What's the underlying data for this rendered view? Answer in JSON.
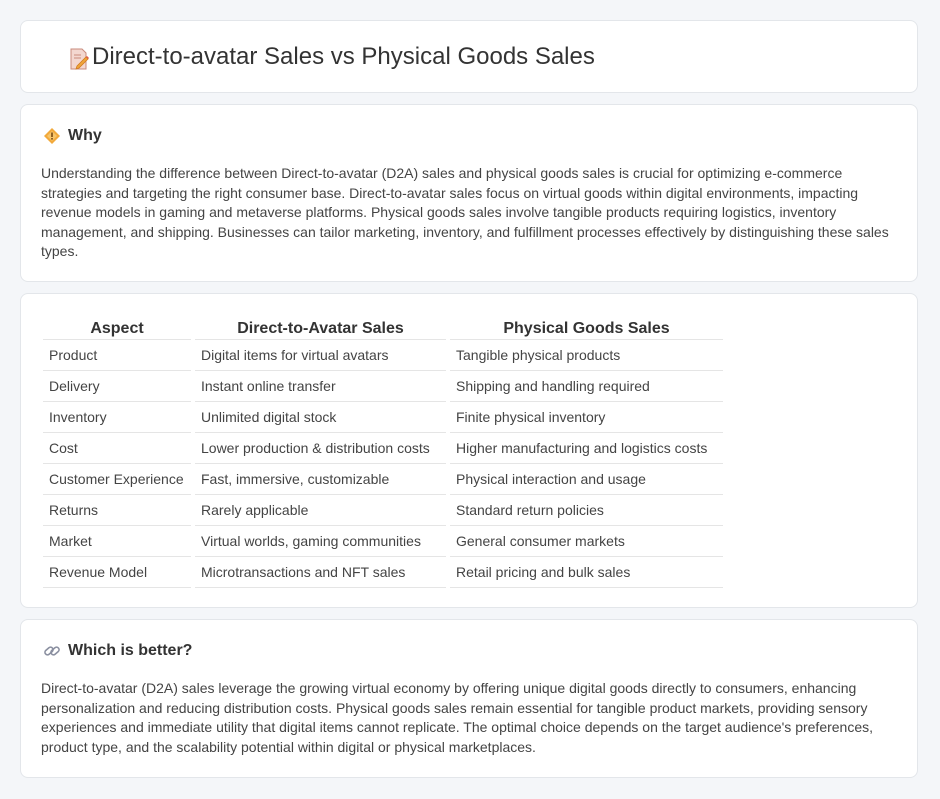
{
  "header": {
    "title": "Direct-to-avatar Sales vs Physical Goods Sales",
    "icon": "document-pencil-icon"
  },
  "why": {
    "heading": "Why",
    "icon": "diamond-warning-icon",
    "text": "Understanding the difference between Direct-to-avatar (D2A) sales and physical goods sales is crucial for optimizing e-commerce strategies and targeting the right consumer base. Direct-to-avatar sales focus on virtual goods within digital environments, impacting revenue models in gaming and metaverse platforms. Physical goods sales involve tangible products requiring logistics, inventory management, and shipping. Businesses can tailor marketing, inventory, and fulfillment processes effectively by distinguishing these sales types."
  },
  "table": {
    "headers": [
      "Aspect",
      "Direct-to-Avatar Sales",
      "Physical Goods Sales"
    ],
    "rows": [
      [
        "Product",
        "Digital items for virtual avatars",
        "Tangible physical products"
      ],
      [
        "Delivery",
        "Instant online transfer",
        "Shipping and handling required"
      ],
      [
        "Inventory",
        "Unlimited digital stock",
        "Finite physical inventory"
      ],
      [
        "Cost",
        "Lower production & distribution costs",
        "Higher manufacturing and logistics costs"
      ],
      [
        "Customer Experience",
        "Fast, immersive, customizable",
        "Physical interaction and usage"
      ],
      [
        "Returns",
        "Rarely applicable",
        "Standard return policies"
      ],
      [
        "Market",
        "Virtual worlds, gaming communities",
        "General consumer markets"
      ],
      [
        "Revenue Model",
        "Microtransactions and NFT sales",
        "Retail pricing and bulk sales"
      ]
    ]
  },
  "better": {
    "heading": "Which is better?",
    "icon": "link-icon",
    "text": "Direct-to-avatar (D2A) sales leverage the growing virtual economy by offering unique digital goods directly to consumers, enhancing personalization and reducing distribution costs. Physical goods sales remain essential for tangible product markets, providing sensory experiences and immediate utility that digital items cannot replicate. The optimal choice depends on the target audience's preferences, product type, and the scalability potential within digital or physical marketplaces."
  }
}
